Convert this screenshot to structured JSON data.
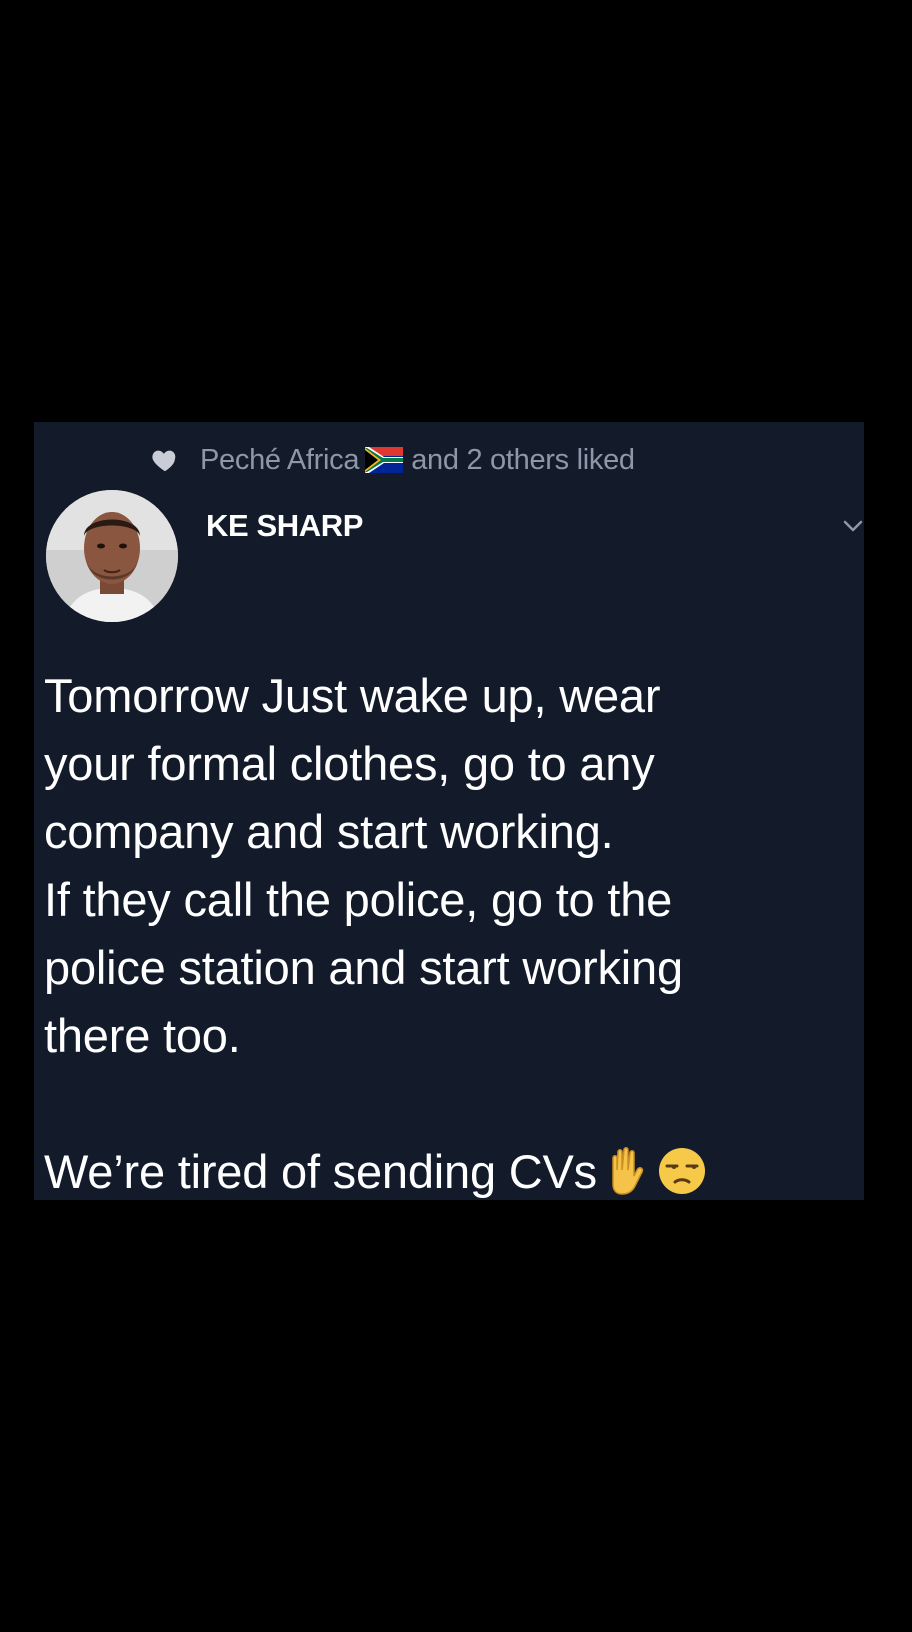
{
  "liked_by": {
    "name": "Peché Africa",
    "flag": "south-africa-flag-icon",
    "suffix": "and 2 others liked"
  },
  "author": {
    "name": "KE SHARP"
  },
  "tweet": {
    "lines": [
      "Tomorrow Just wake up, wear",
      "your formal clothes, go to any",
      "company and start working.",
      "If they call the police, go to the",
      "police station and start working",
      "there too."
    ],
    "closing": "We’re tired of sending CVs",
    "emojis": [
      "raised-hand-icon",
      "unamused-face-icon"
    ]
  },
  "colors": {
    "background": "#000000",
    "card": "#131b2b",
    "muted_text": "#8e97a6",
    "text": "#ffffff"
  }
}
